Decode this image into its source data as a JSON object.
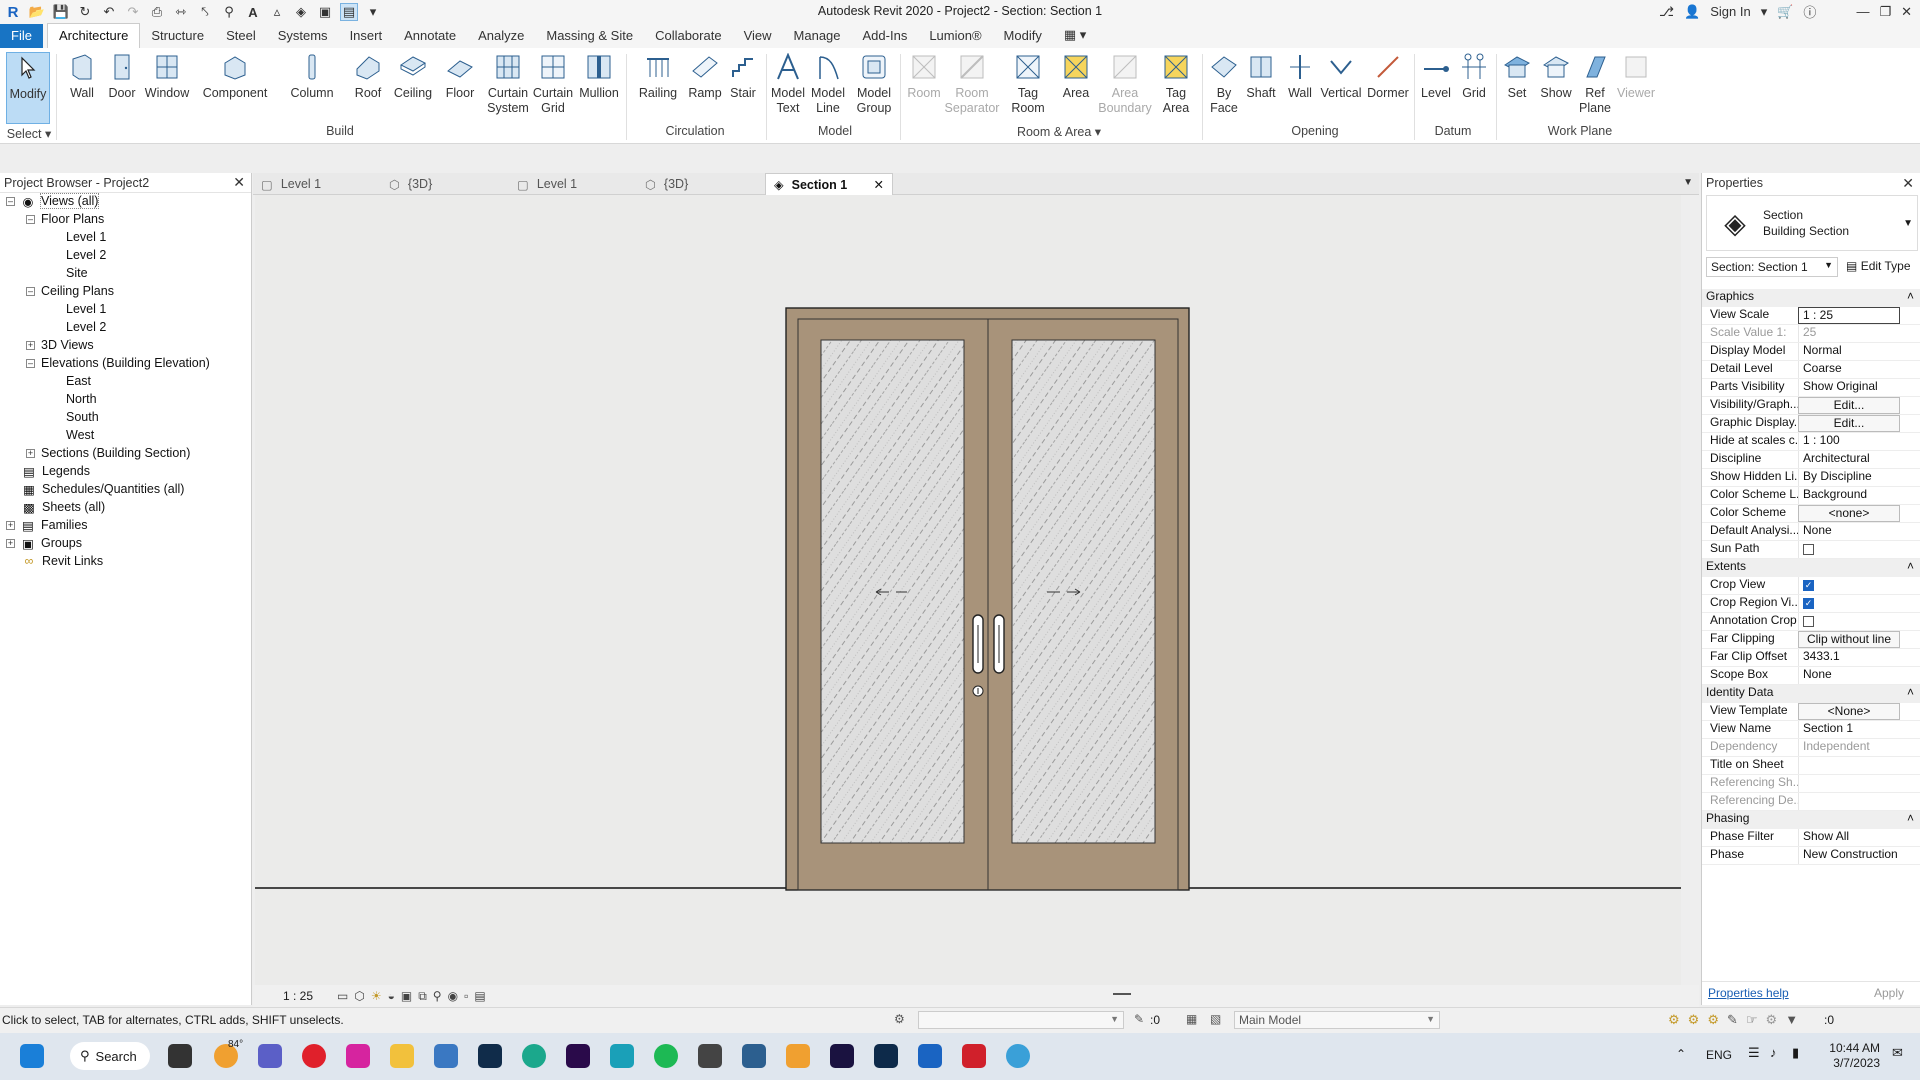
{
  "title": "Autodesk Revit 2020 - Project2 - Section: Section 1",
  "titlebar": {
    "sign_in": "Sign In"
  },
  "menu": [
    "File",
    "Architecture",
    "Structure",
    "Steel",
    "Systems",
    "Insert",
    "Annotate",
    "Analyze",
    "Massing & Site",
    "Collaborate",
    "View",
    "Manage",
    "Add-Ins",
    "Lumion®",
    "Modify"
  ],
  "ribbon": {
    "modify": "Modify",
    "select": "Select",
    "build": [
      "Wall",
      "Door",
      "Window",
      "Component",
      "Column",
      "Roof",
      "Ceiling",
      "Floor",
      "Curtain\nSystem",
      "Curtain\nGrid",
      "Mullion"
    ],
    "circulation": [
      "Railing",
      "Ramp",
      "Stair"
    ],
    "model": [
      "Model\nText",
      "Model\nLine",
      "Model\nGroup"
    ],
    "room_area": [
      "Room",
      "Room\nSeparator",
      "Tag\nRoom",
      "Area",
      "Area\nBoundary",
      "Tag\nArea"
    ],
    "opening": [
      "By\nFace",
      "Shaft",
      "Wall",
      "Vertical",
      "Dormer"
    ],
    "datum": [
      "Level",
      "Grid"
    ],
    "work_plane": [
      "Set",
      "Show",
      "Ref\nPlane",
      "Viewer"
    ],
    "panels": {
      "build": "Build",
      "circulation": "Circulation",
      "model": "Model",
      "room_area": "Room & Area",
      "opening": "Opening",
      "datum": "Datum",
      "work_plane": "Work Plane"
    }
  },
  "project_browser": {
    "title": "Project Browser - Project2",
    "nodes": [
      "Views (all)",
      "Floor Plans",
      "Level 1",
      "Level 2",
      "Site",
      "Ceiling Plans",
      "Level 1",
      "Level 2",
      "3D Views",
      "Elevations (Building Elevation)",
      "East",
      "North",
      "South",
      "West",
      "Sections (Building Section)",
      "Legends",
      "Schedules/Quantities (all)",
      "Sheets (all)",
      "Families",
      "Groups",
      "Revit Links"
    ]
  },
  "view_tabs": [
    "Level 1",
    "{3D}",
    "Level 1",
    "{3D}",
    "Section 1"
  ],
  "view_control": {
    "scale": "1 : 25"
  },
  "properties": {
    "title": "Properties",
    "type_name": "Section",
    "type_sub": "Building Section",
    "instance": "Section: Section 1",
    "edit_type": "Edit Type",
    "groups": {
      "graphics": "Graphics",
      "extents": "Extents",
      "identity": "Identity Data",
      "phasing": "Phasing"
    },
    "rows": [
      [
        "View Scale",
        "1 : 25"
      ],
      [
        "Scale Value    1:",
        "25"
      ],
      [
        "Display Model",
        "Normal"
      ],
      [
        "Detail Level",
        "Coarse"
      ],
      [
        "Parts Visibility",
        "Show Original"
      ],
      [
        "Visibility/Graph...",
        "Edit..."
      ],
      [
        "Graphic Display...",
        "Edit..."
      ],
      [
        "Hide at scales c...",
        "1 : 100"
      ],
      [
        "Discipline",
        "Architectural"
      ],
      [
        "Show Hidden Li...",
        "By Discipline"
      ],
      [
        "Color Scheme L...",
        "Background"
      ],
      [
        "Color Scheme",
        "<none>"
      ],
      [
        "Default Analysi...",
        "None"
      ],
      [
        "Sun Path",
        ""
      ],
      [
        "Crop View",
        ""
      ],
      [
        "Crop Region Vi...",
        ""
      ],
      [
        "Annotation Crop",
        ""
      ],
      [
        "Far Clipping",
        "Clip without line"
      ],
      [
        "Far Clip Offset",
        "3433.1"
      ],
      [
        "Scope Box",
        "None"
      ],
      [
        "View Template",
        "<None>"
      ],
      [
        "View Name",
        "Section 1"
      ],
      [
        "Dependency",
        "Independent"
      ],
      [
        "Title on Sheet",
        ""
      ],
      [
        "Referencing Sh...",
        ""
      ],
      [
        "Referencing De...",
        ""
      ],
      [
        "Phase Filter",
        "Show All"
      ],
      [
        "Phase",
        "New Construction"
      ]
    ],
    "help": "Properties help",
    "apply": "Apply"
  },
  "status": {
    "hint": "Click to select, TAB for alternates, CTRL adds, SHIFT unselects.",
    "count": ":0",
    "model": "Main Model",
    "filter": ":0"
  },
  "taskbar": {
    "search": "Search",
    "weather": "84°",
    "lang": "ENG",
    "time": "10:44 AM",
    "date": "3/7/2023"
  }
}
